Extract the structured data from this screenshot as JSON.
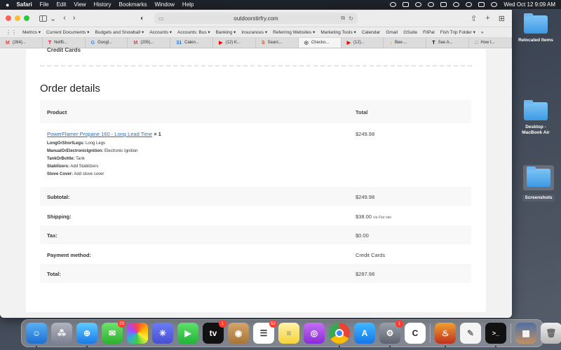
{
  "menubar": {
    "apple": "",
    "items": [
      "Safari",
      "File",
      "Edit",
      "View",
      "History",
      "Bookmarks",
      "Window",
      "Help"
    ],
    "clock": "Wed Oct 12  9:09 AM"
  },
  "safari": {
    "url": "outdoorstirfry.com",
    "bookmarks": [
      "Metrics ▾",
      "Current Documents ▾",
      "Budgets and Snowball ▾",
      "Accounts ▾",
      "Accounts: Bus ▾",
      "Banking ▾",
      "Insurances ▾",
      "Referring Websites ▾",
      "Marketing Tools ▾",
      "Calendar",
      "Gmail",
      "GSuite",
      "FitPal",
      "Fish Trip Folder ▾",
      "»"
    ],
    "tabs": [
      {
        "icon": "M",
        "label": "(264)..."
      },
      {
        "icon": "T",
        "label": "Netfli..."
      },
      {
        "icon": "G",
        "label": "Googl..."
      },
      {
        "icon": "M",
        "label": "(205)..."
      },
      {
        "icon": "31",
        "label": "Calen..."
      },
      {
        "icon": "▶",
        "label": "(12) K..."
      },
      {
        "icon": "S",
        "label": "Searc..."
      },
      {
        "icon": "◎",
        "label": "Checko..."
      },
      {
        "icon": "▶",
        "label": "(12)..."
      },
      {
        "icon": "♪",
        "label": "Bee-..."
      },
      {
        "icon": "T",
        "label": "See A..."
      },
      {
        "icon": "□",
        "label": "How t..."
      }
    ]
  },
  "page": {
    "strip_text": "Credit Cards",
    "order_title": "Order details",
    "table": {
      "headers": {
        "product": "Product",
        "total": "Total"
      },
      "item": {
        "name": "PowerFlamer Propane 160 - Long Lead Time",
        "qty": "× 1",
        "price": "$249.98",
        "meta": [
          {
            "key": "LongOrShortLegs:",
            "value": "Long Legs"
          },
          {
            "key": "ManualOrElectronicIgnition:",
            "value": "Electronic Ignition"
          },
          {
            "key": "TankOrBottle:",
            "value": "Tank"
          },
          {
            "key": "Stabilizers:",
            "value": "Add Stabilizers"
          },
          {
            "key": "Stove Cover:",
            "value": "Add stove cover"
          }
        ]
      },
      "totals": [
        {
          "label": "Subtotal:",
          "value": "$249.98",
          "note": ""
        },
        {
          "label": "Shipping:",
          "value": "$38.00",
          "note": "via Flat rate"
        },
        {
          "label": "Tax:",
          "value": "$0.00",
          "note": ""
        },
        {
          "label": "Payment method:",
          "value": "Credit Cards",
          "note": ""
        },
        {
          "label": "Total:",
          "value": "$287.98",
          "note": ""
        }
      ]
    }
  },
  "desktop": {
    "items": [
      "Relocated Items",
      "Desktop - MacBook Air",
      "Screenshots"
    ]
  },
  "dock": {
    "badges": {
      "messages": "23",
      "appletv": "1",
      "reminders": "52",
      "settings": "1"
    }
  }
}
